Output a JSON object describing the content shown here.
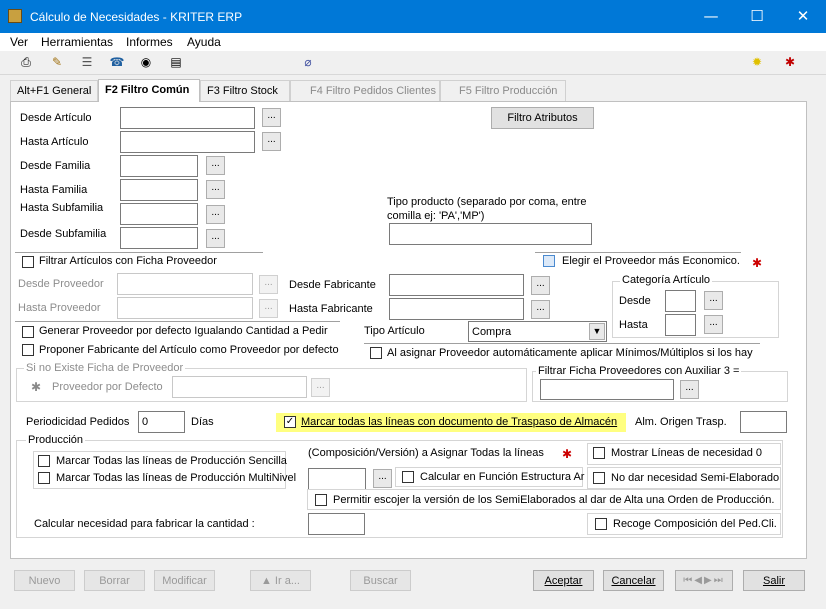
{
  "window": {
    "title": "Cálculo de Necesidades - KRITER ERP",
    "minimize": "—",
    "maximize": "☐",
    "close": "✕"
  },
  "menu": [
    "Ver",
    "Herramientas",
    "Informes",
    "Ayuda"
  ],
  "toolbar_icons": [
    "printer-icon",
    "pencil-icon",
    "list-icon",
    "phone-icon",
    "eye-icon",
    "print-preview-icon",
    "paperclip-icon",
    "lightbulb-icon",
    "gear-help-icon"
  ],
  "tabs": [
    {
      "label": "Alt+F1 General",
      "state": "normal"
    },
    {
      "label": "F2 Filtro Común",
      "state": "active"
    },
    {
      "label": "F3 Filtro Stock",
      "state": "normal"
    },
    {
      "label": "F4 Filtro Pedidos Clientes",
      "state": "disabled"
    },
    {
      "label": "F5 Filtro Producción",
      "state": "disabled"
    }
  ],
  "filters": {
    "desde_articulo": "Desde Artículo",
    "hasta_articulo": "Hasta Artículo",
    "desde_familia": "Desde Familia",
    "hasta_familia": "Hasta Familia",
    "hasta_subfamilia": "Hasta Subfamilia",
    "desde_subfamilia": "Desde Subfamilia",
    "filtro_atributos": "Filtro Atributos",
    "tipo_producto_label": "Tipo producto (separado por coma, entre comilla ej:  'PA','MP')",
    "dots": "..."
  },
  "proveedor": {
    "filtrar_ficha": "Filtrar Artículos con Ficha Proveedor",
    "elegir_economico": "Elegir el Proveedor más Economico.",
    "desde_proveedor": "Desde Proveedor",
    "hasta_proveedor": "Hasta Proveedor",
    "desde_fabricante": "Desde Fabricante",
    "hasta_fabricante": "Hasta Fabricante",
    "categoria_articulo": "Categoría Artículo",
    "cat_desde": "Desde",
    "cat_hasta": "Hasta",
    "generar_proveedor": "Generar Proveedor por defecto Igualando Cantidad a Pedir",
    "proponer_fabricante": "Proponer Fabricante del Artículo como Proveedor por defecto",
    "tipo_articulo": "Tipo Artículo",
    "tipo_articulo_value": "Compra",
    "asignar_minimos": "Al asignar Proveedor automáticamente aplicar Mínimos/Múltiplos si los hay",
    "si_no_existe": "Si no Existe Ficha de Proveedor",
    "proveedor_defecto": "Proveedor por Defecto",
    "filtrar_ficha_aux": "Filtrar Ficha Proveedores con Auxiliar 3 ="
  },
  "periodicidad": {
    "label": "Periodicidad Pedidos",
    "value": "0",
    "unit": "Días",
    "marcar_traspaso": "Marcar todas las líneas con documento de Traspaso de Almacén",
    "alm_origen": "Alm. Origen Trasp."
  },
  "produccion": {
    "group": "Producción",
    "marcar_sencilla": "Marcar Todas las líneas de Producción Sencilla",
    "marcar_multinivel": "Marcar Todas las líneas de Producción MultiNivel",
    "composicion_version": "(Composición/Versión) a Asignar Todas la líneas",
    "calcular_estructura": "Calcular en Función Estructura Ar",
    "mostrar_necesidad": "Mostrar Líneas de necesidad 0",
    "no_dar_necesidad": "No dar necesidad Semi-Elaborado",
    "permitir_version": "Permitir escojer la versión de los SemiElaborados al dar de Alta una Orden de Producción.",
    "calcular_cantidad": "Calcular necesidad para fabricar la cantidad :",
    "recoge_composicion": "Recoge Composición del Ped.Cli."
  },
  "footer": {
    "nuevo": "Nuevo",
    "borrar": "Borrar",
    "modificar": "Modificar",
    "ir_a": "▲ Ir a...",
    "buscar": "Buscar",
    "aceptar": "Aceptar",
    "cancelar": "Cancelar",
    "salir": "Salir"
  }
}
